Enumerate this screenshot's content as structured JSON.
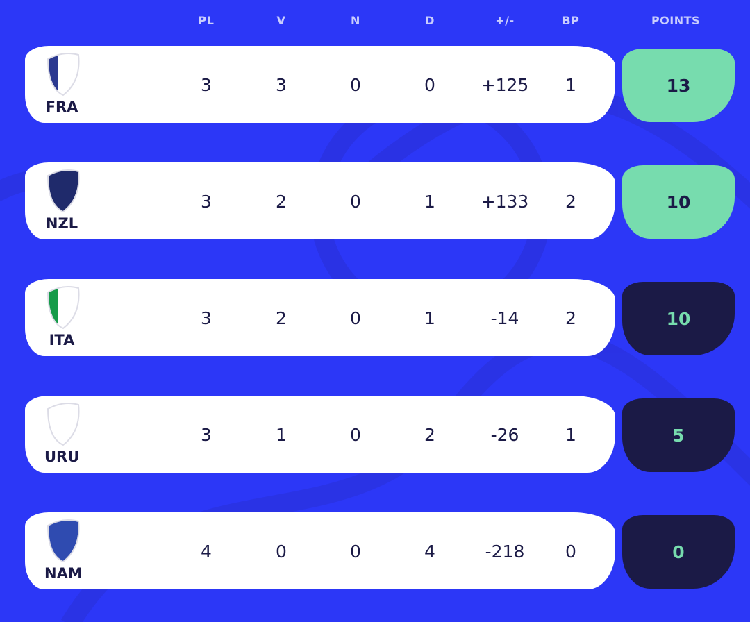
{
  "headers": {
    "pl": "PL",
    "v": "V",
    "n": "N",
    "d": "D",
    "diff": "+/-",
    "bp": "BP",
    "points": "POINTS"
  },
  "colors": {
    "background": "#2c37f7",
    "qualified": "#77dcae",
    "navy": "#1b1a46"
  },
  "rows": [
    {
      "team": "FRA",
      "flag": "france-flag-icon",
      "pl": "3",
      "v": "3",
      "n": "0",
      "d": "0",
      "diff": "+125",
      "bp": "1",
      "points": "13",
      "highlight": true
    },
    {
      "team": "NZL",
      "flag": "new-zealand-flag-icon",
      "pl": "3",
      "v": "2",
      "n": "0",
      "d": "1",
      "diff": "+133",
      "bp": "2",
      "points": "10",
      "highlight": true
    },
    {
      "team": "ITA",
      "flag": "italy-flag-icon",
      "pl": "3",
      "v": "2",
      "n": "0",
      "d": "1",
      "diff": "-14",
      "bp": "2",
      "points": "10",
      "highlight": false
    },
    {
      "team": "URU",
      "flag": "uruguay-flag-icon",
      "pl": "3",
      "v": "1",
      "n": "0",
      "d": "2",
      "diff": "-26",
      "bp": "1",
      "points": "5",
      "highlight": false
    },
    {
      "team": "NAM",
      "flag": "namibia-flag-icon",
      "pl": "4",
      "v": "0",
      "n": "0",
      "d": "4",
      "diff": "-218",
      "bp": "0",
      "points": "0",
      "highlight": false
    }
  ]
}
